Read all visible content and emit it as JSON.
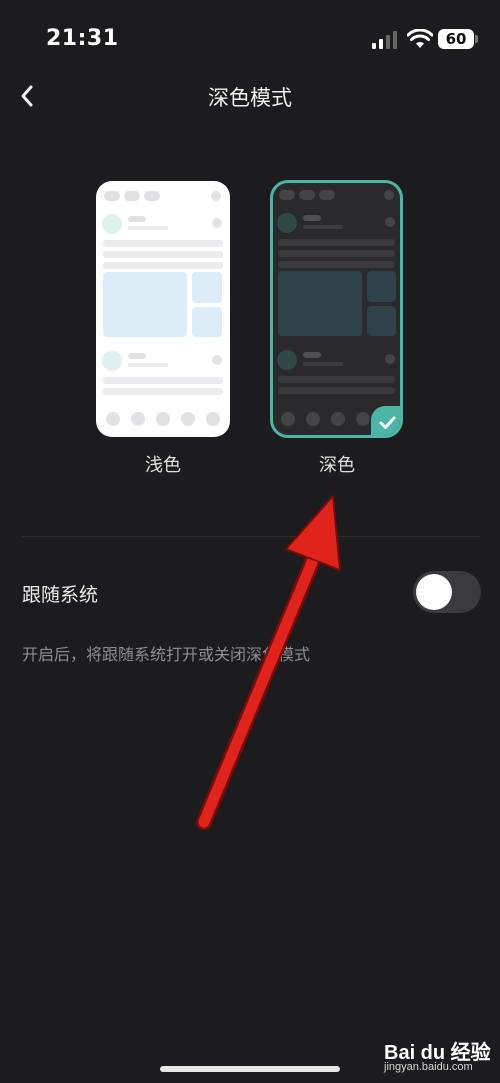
{
  "status": {
    "time": "21:31",
    "battery": "60"
  },
  "nav": {
    "title": "深色模式"
  },
  "themes": {
    "light_label": "浅色",
    "dark_label": "深色",
    "selected": "dark"
  },
  "follow_system": {
    "label": "跟随系统",
    "description": "开启后，将跟随系统打开或关闭深色模式",
    "enabled": false
  },
  "watermark": {
    "brand": "Bai du 经验",
    "url": "jingyan.baidu.com"
  },
  "colors": {
    "accent": "#4bb5a6",
    "arrow": "#e0231c",
    "background": "#1c1b1d"
  }
}
